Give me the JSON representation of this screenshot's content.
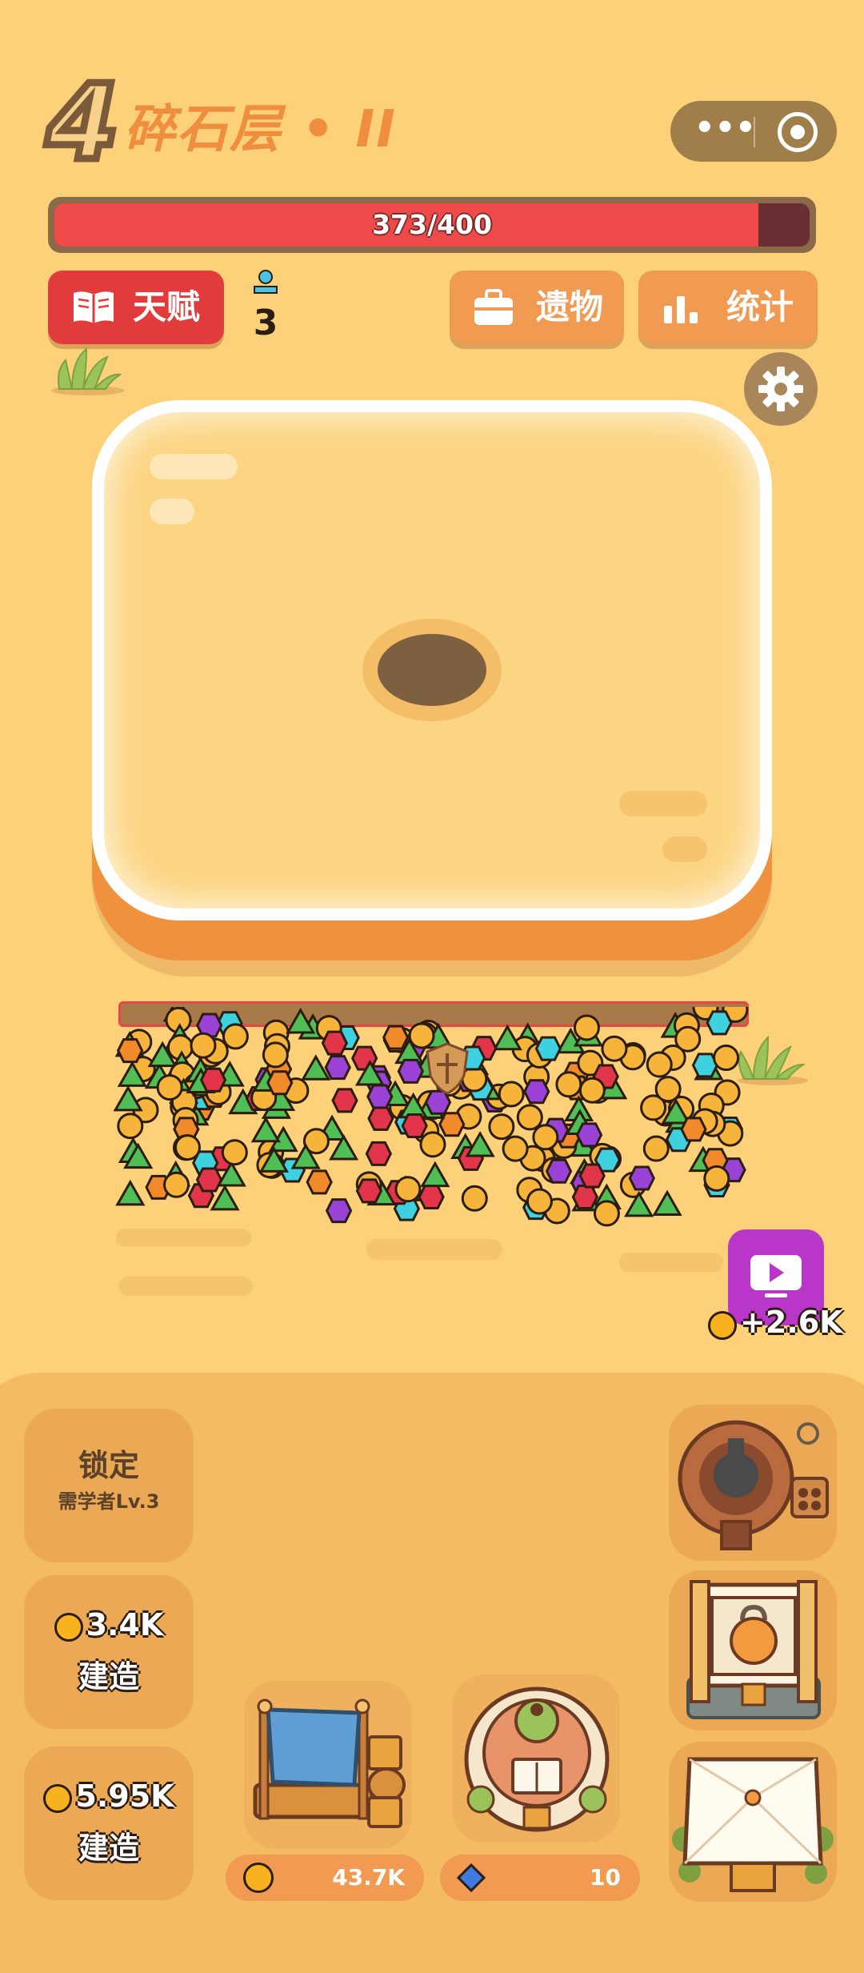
{
  "header": {
    "level_number": "4",
    "level_name": "碎石层 • II",
    "menu_dots": "•••"
  },
  "hp": {
    "text": "373/400",
    "current": 373,
    "max": 400
  },
  "buttons": {
    "talent": "天赋",
    "relic": "遗物",
    "stats": "统计"
  },
  "talent_points": "3",
  "ad_bonus": "+2.6K",
  "build_slots": [
    {
      "line1": "锁定",
      "line2": "需学者Lv.3"
    },
    {
      "cost": "3.4K",
      "action": "建造"
    },
    {
      "cost": "5.95K",
      "action": "建造"
    }
  ],
  "resources": {
    "coins": "43.7K",
    "gems": "10"
  },
  "colors": {
    "background": "#fcd17a",
    "accent_red": "#e23b3b",
    "accent_orange": "#f19a52",
    "video_purple": "#b836c8"
  },
  "icons": {
    "talent": "book-icon",
    "relic": "briefcase-icon",
    "stats": "bar-chart-icon",
    "settings": "gear-icon",
    "video": "play-video-icon"
  }
}
